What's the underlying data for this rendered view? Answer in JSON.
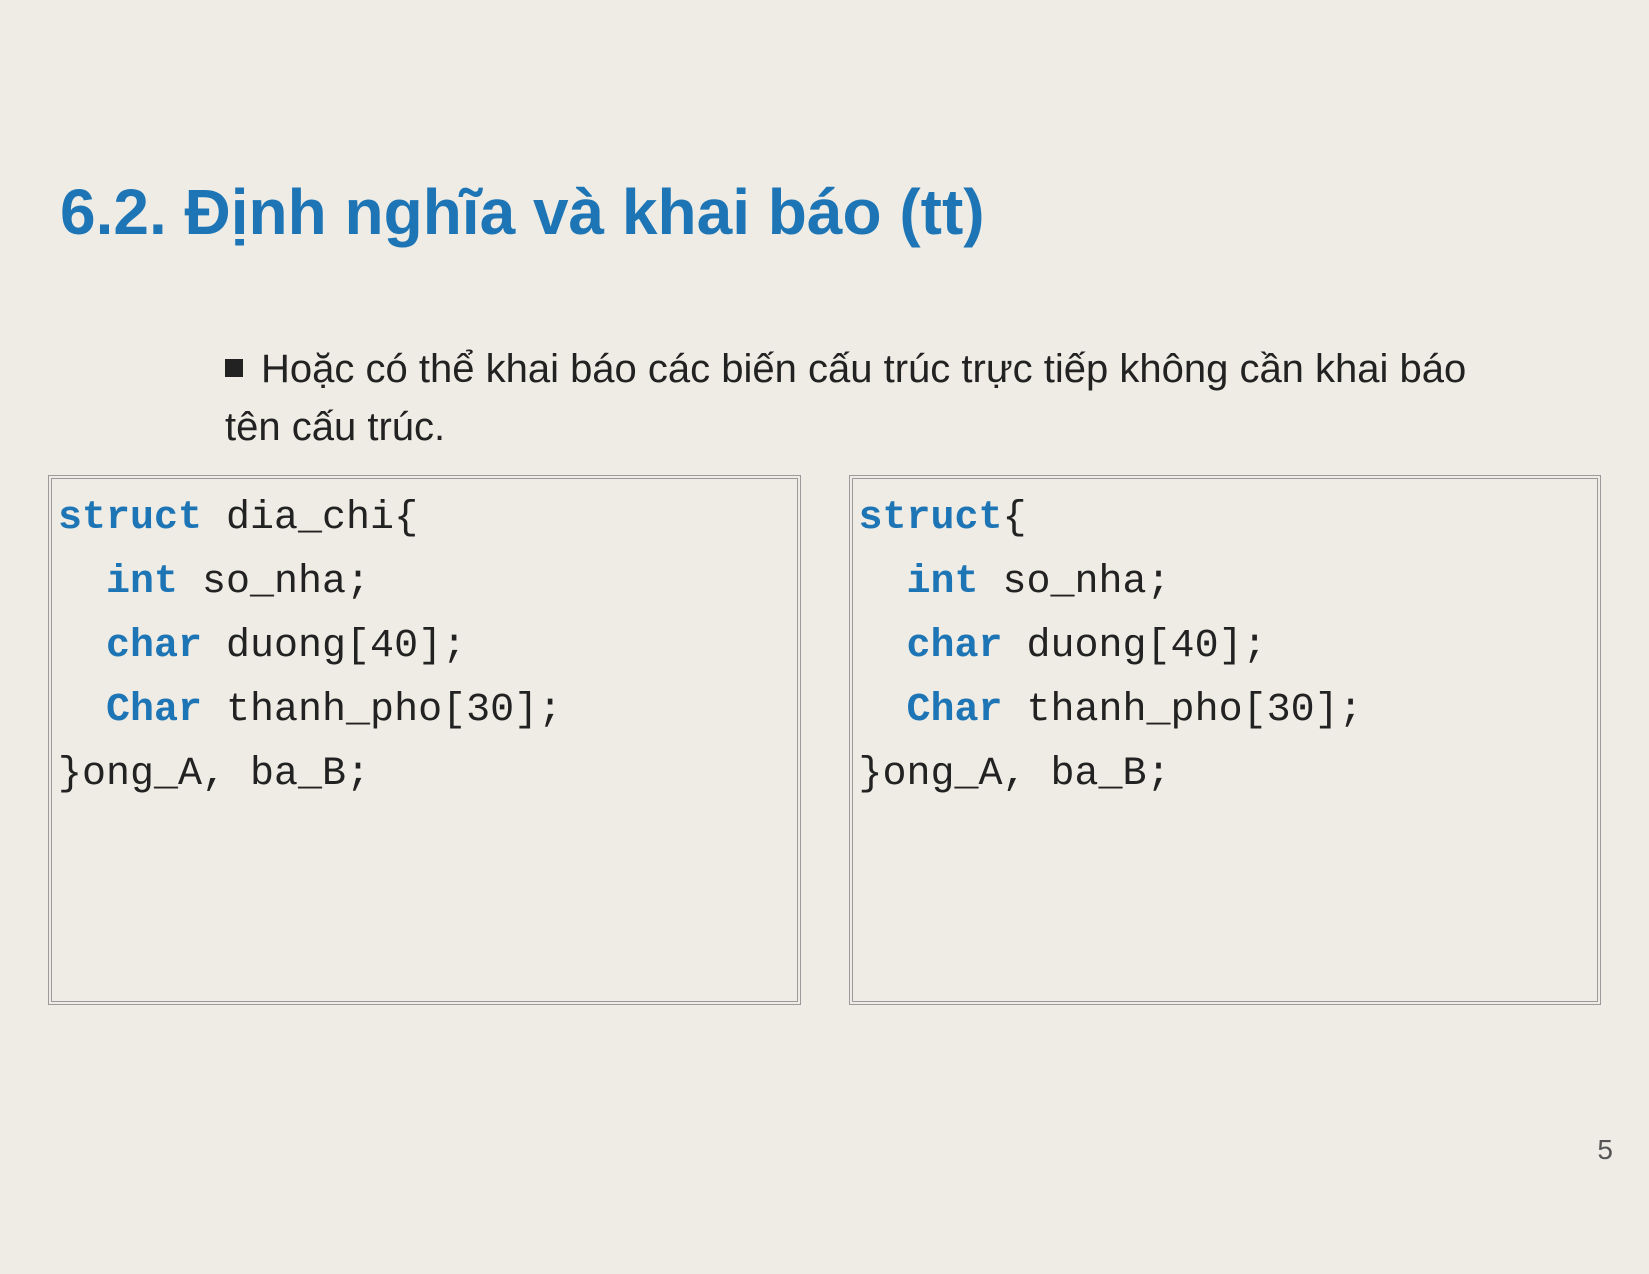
{
  "title": "6.2. Định nghĩa và khai báo (tt)",
  "bullet": "Hoặc có thể khai báo các biến cấu trúc trực tiếp không cần khai báo tên cấu trúc.",
  "code_left": {
    "kw_struct": "struct",
    "decl": " dia_chi{",
    "kw_int": "int",
    "line_int": " so_nha;",
    "kw_char1": "char",
    "line_char1": " duong[40];",
    "kw_char2": "Char",
    "line_char2": " thanh_pho[30];",
    "close": "}ong_A, ba_B;"
  },
  "code_right": {
    "kw_struct": "struct",
    "decl": "{",
    "kw_int": "int",
    "line_int": " so_nha;",
    "kw_char1": "char",
    "line_char1": " duong[40];",
    "kw_char2": "Char",
    "line_char2": " thanh_pho[30];",
    "close": "}ong_A, ba_B;"
  },
  "page_number": "5"
}
